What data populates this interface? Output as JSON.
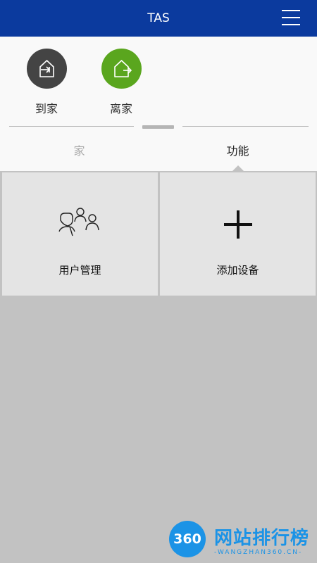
{
  "app": {
    "title": "TAS"
  },
  "modes": {
    "home": {
      "label": "到家",
      "icon": "arrive-home-icon",
      "color": "#444444"
    },
    "away": {
      "label": "离家",
      "icon": "leave-home-icon",
      "color": "#5aa61e"
    }
  },
  "tabs": [
    {
      "label": "家",
      "active": false
    },
    {
      "label": "功能",
      "active": true
    }
  ],
  "functions": [
    {
      "label": "用户管理",
      "icon": "users-icon"
    },
    {
      "label": "添加设备",
      "icon": "plus-icon"
    }
  ],
  "watermark": {
    "logo_text": "360",
    "title": "网站排行榜",
    "subtitle": "-WANGZHAN360.CN-"
  },
  "colors": {
    "header": "#0b3a9e",
    "accent_green": "#5aa61e",
    "background": "#c2c2c2",
    "tile": "#e4e4e4"
  }
}
